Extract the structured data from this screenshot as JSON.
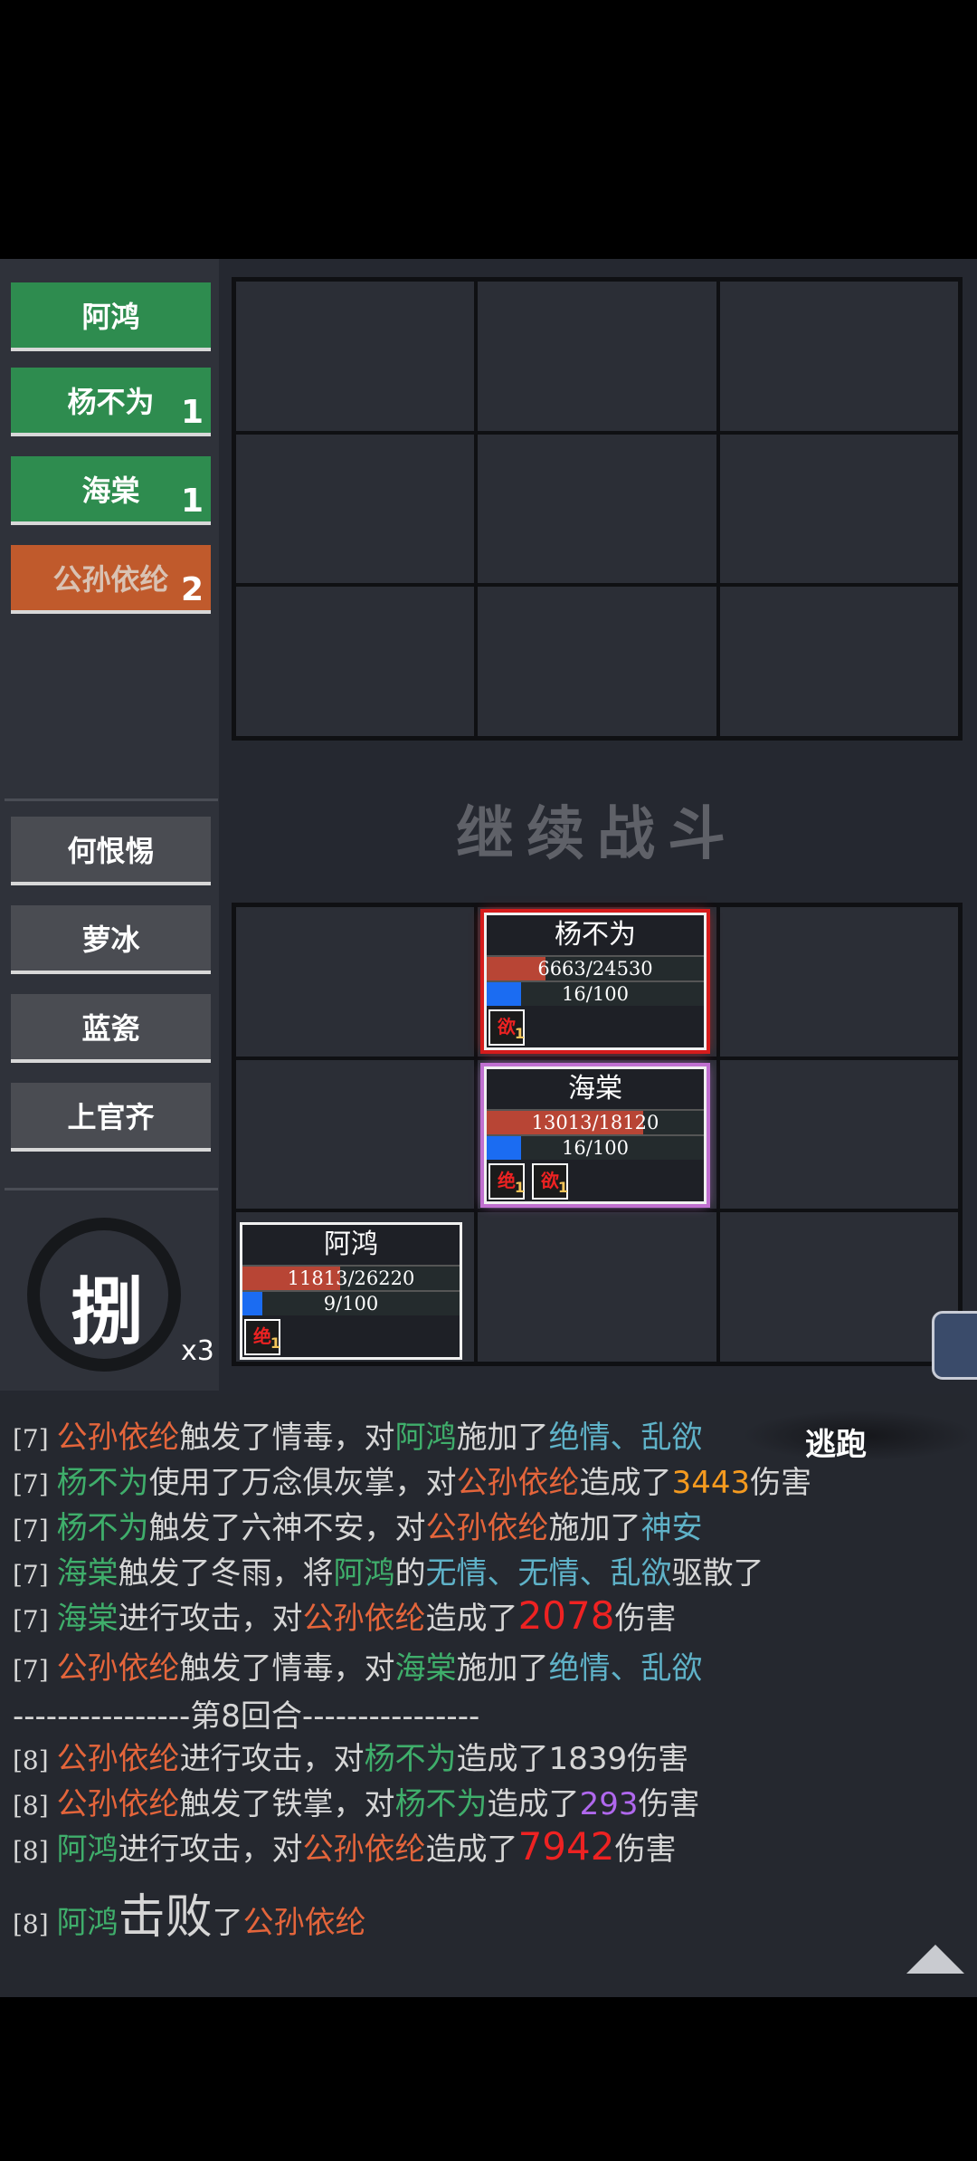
{
  "teams": {
    "top": [
      {
        "name": "阿鸿",
        "count": "",
        "color": "green"
      },
      {
        "name": "杨不为",
        "count": "1",
        "color": "green"
      },
      {
        "name": "海棠",
        "count": "1",
        "color": "green"
      },
      {
        "name": "公孙依纶",
        "count": "2",
        "color": "orange"
      }
    ],
    "bottom": [
      {
        "name": "何恨惕"
      },
      {
        "name": "萝冰"
      },
      {
        "name": "蓝瓷"
      },
      {
        "name": "上官齐"
      }
    ]
  },
  "continue_label": "继续战斗",
  "cards": {
    "yang": {
      "name": "杨不为",
      "hp": "6663/24530",
      "hp_frac": 0.27,
      "mp": "16/100",
      "mp_frac": 0.16,
      "buffs": [
        {
          "glyph": "欲",
          "n": "1"
        }
      ]
    },
    "hai": {
      "name": "海棠",
      "hp": "13013/18120",
      "hp_frac": 0.72,
      "mp": "16/100",
      "mp_frac": 0.16,
      "buffs": [
        {
          "glyph": "绝",
          "n": "1"
        },
        {
          "glyph": "欲",
          "n": "1"
        }
      ]
    },
    "ahong": {
      "name": "阿鸿",
      "hp": "11813/26220",
      "hp_frac": 0.45,
      "mp": "9/100",
      "mp_frac": 0.09,
      "buffs": [
        {
          "glyph": "绝",
          "n": "1"
        }
      ]
    }
  },
  "skill": {
    "glyph": "捌",
    "times": "x3"
  },
  "flee_label": "逃跑",
  "log": [
    [
      [
        "t",
        "[7] "
      ],
      [
        "c-or",
        "公孙依纶"
      ],
      [
        "",
        "触发了情毒，对"
      ],
      [
        "c-gr",
        "阿鸿"
      ],
      [
        "",
        "施加了"
      ],
      [
        "c-bl",
        "绝情、乱欲"
      ]
    ],
    [
      [
        "t",
        "[7] "
      ],
      [
        "c-gr",
        "杨不为"
      ],
      [
        "",
        "使用了万念俱灰掌，对"
      ],
      [
        "c-or",
        "公孙依纶"
      ],
      [
        "",
        "造成了"
      ],
      [
        "c-yl",
        "3443"
      ],
      [
        "",
        "伤害"
      ]
    ],
    [
      [
        "t",
        "[7] "
      ],
      [
        "c-gr",
        "杨不为"
      ],
      [
        "",
        "触发了六神不安，对"
      ],
      [
        "c-or",
        "公孙依纶"
      ],
      [
        "",
        "施加了"
      ],
      [
        "c-bl",
        "神安"
      ]
    ],
    [
      [
        "t",
        "[7] "
      ],
      [
        "c-gr",
        "海棠"
      ],
      [
        "",
        "触发了冬雨，将"
      ],
      [
        "c-gr",
        "阿鸿"
      ],
      [
        "",
        "的"
      ],
      [
        "c-bl",
        "无情、无情、乱欲"
      ],
      [
        "",
        "驱散了"
      ]
    ],
    [
      [
        "t",
        "[7] "
      ],
      [
        "c-gr",
        "海棠"
      ],
      [
        "",
        "进行攻击，对"
      ],
      [
        "c-or",
        "公孙依纶"
      ],
      [
        "",
        "造成了"
      ],
      [
        "c-rd big",
        "2078"
      ],
      [
        "",
        "伤害"
      ]
    ],
    [
      [
        "t",
        "[7] "
      ],
      [
        "c-or",
        "公孙依纶"
      ],
      [
        "",
        "触发了情毒，对"
      ],
      [
        "c-gr",
        "海棠"
      ],
      [
        "",
        "施加了"
      ],
      [
        "c-bl",
        "绝情、乱欲"
      ]
    ],
    [
      [
        "",
        "----------------第8回合----------------"
      ]
    ],
    [
      [
        "t",
        "[8] "
      ],
      [
        "c-or",
        "公孙依纶"
      ],
      [
        "",
        "进行攻击，对"
      ],
      [
        "c-gr",
        "杨不为"
      ],
      [
        "",
        "造成了1839伤害"
      ]
    ],
    [
      [
        "t",
        "[8] "
      ],
      [
        "c-or",
        "公孙依纶"
      ],
      [
        "",
        "触发了铁掌，对"
      ],
      [
        "c-gr",
        "杨不为"
      ],
      [
        "",
        "造成了"
      ],
      [
        "c-pu",
        "293"
      ],
      [
        "",
        "伤害"
      ]
    ],
    [
      [
        "t",
        "[8] "
      ],
      [
        "c-gr",
        "阿鸿"
      ],
      [
        "",
        "进行攻击，对"
      ],
      [
        "c-or",
        "公孙依纶"
      ],
      [
        "",
        "造成了"
      ],
      [
        "c-rd big",
        "7942"
      ],
      [
        "",
        "伤害"
      ]
    ],
    [
      [
        "t",
        "[8] "
      ],
      [
        "c-gr",
        "阿鸿"
      ],
      [
        "huge",
        "击败"
      ],
      [
        "",
        "了"
      ],
      [
        "c-or",
        "公孙依纶"
      ]
    ]
  ]
}
